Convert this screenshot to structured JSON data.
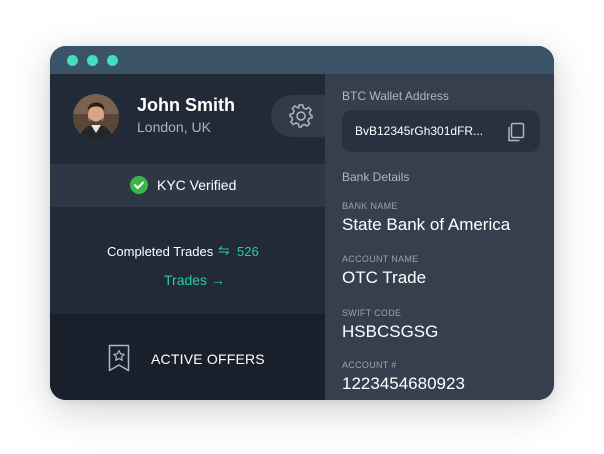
{
  "profile": {
    "name": "John Smith",
    "location": "London, UK",
    "avatar_icon": "user-avatar"
  },
  "kyc": {
    "label": "KYC Verified",
    "color": "#3bb54a"
  },
  "trades": {
    "completed_label": "Completed Trades",
    "count": "526",
    "link_label": "Trades →",
    "accent": "#2bc9a0"
  },
  "offers": {
    "label": "ACTIVE OFFERS",
    "icon": "bookmark-star-icon"
  },
  "wallet": {
    "heading": "BTC Wallet Address",
    "address": "BvB12345rGh301dFR..."
  },
  "bank": {
    "heading": "Bank Details",
    "fields": [
      {
        "label": "BANK NAME",
        "value": "State Bank of America"
      },
      {
        "label": "ACCOUNT NAME",
        "value": "OTC Trade"
      },
      {
        "label": "SWIFT CODE",
        "value": "HSBCSGSG"
      },
      {
        "label": "ACCOUNT #",
        "value": "1223454680923"
      }
    ]
  },
  "colors": {
    "titlebar": "#3a5366",
    "window_dots": "#3ee0b9"
  }
}
